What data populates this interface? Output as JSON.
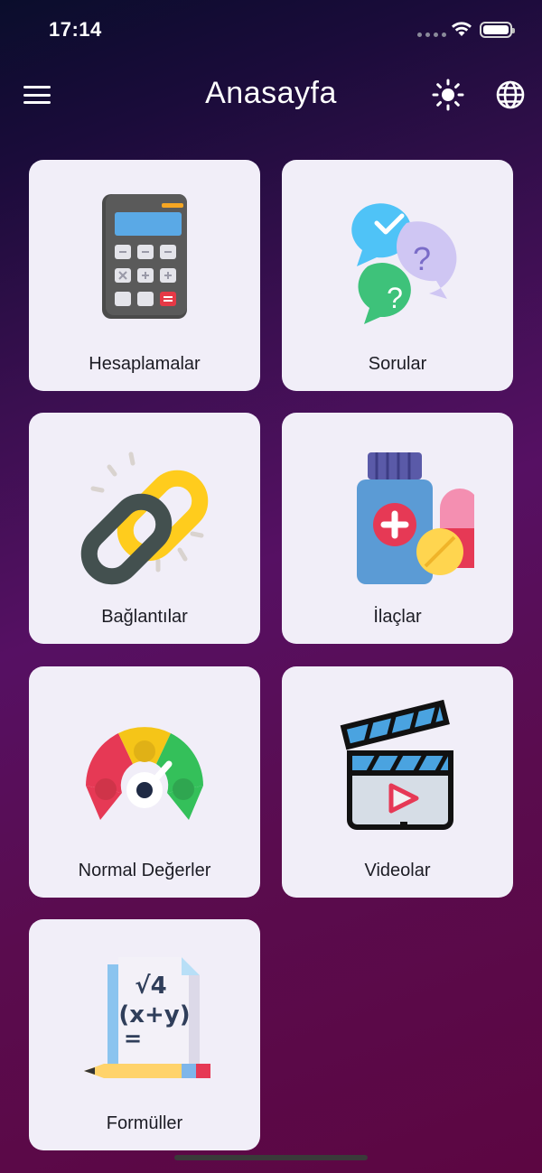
{
  "status": {
    "time": "17:14"
  },
  "header": {
    "title": "Anasayfa"
  },
  "menu": {
    "items": [
      {
        "key": "calc",
        "label": "Hesaplamalar"
      },
      {
        "key": "questions",
        "label": "Sorular"
      },
      {
        "key": "links",
        "label": "Bağlantılar"
      },
      {
        "key": "drugs",
        "label": "İlaçlar"
      },
      {
        "key": "normals",
        "label": "Normal Değerler"
      },
      {
        "key": "videos",
        "label": "Videolar"
      },
      {
        "key": "formulas",
        "label": "Formüller"
      }
    ]
  },
  "icons": {
    "menu": "hamburger-icon",
    "theme": "sun-icon",
    "language": "globe-icon"
  },
  "colors": {
    "card": "#f1eef8",
    "text": "#1c1c24"
  }
}
